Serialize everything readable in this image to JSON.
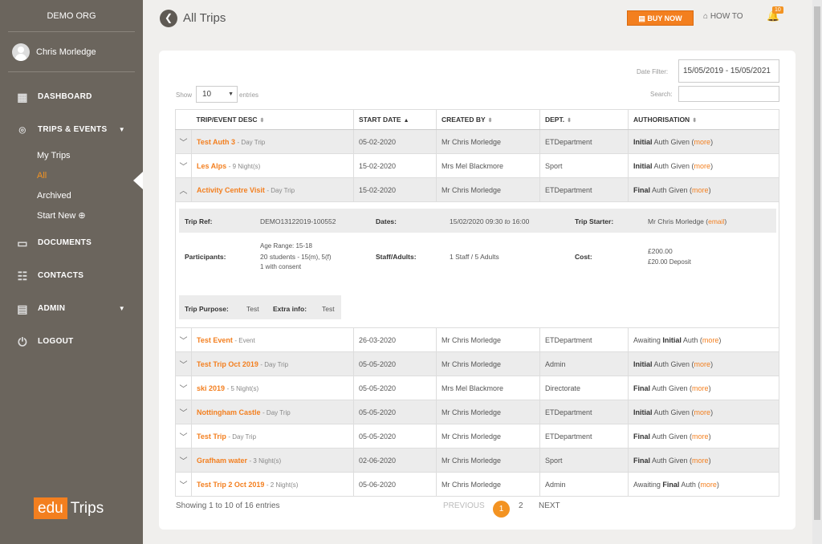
{
  "org": "DEMO ORG",
  "user": "Chris Morledge",
  "nav": {
    "dashboard": "DASHBOARD",
    "trips": "TRIPS & EVENTS",
    "my_trips": "My Trips",
    "all": "All",
    "archived": "Archived",
    "start_new": "Start New",
    "documents": "DOCUMENTS",
    "contacts": "CONTACTS",
    "admin": "ADMIN",
    "logout": "LOGOUT"
  },
  "logo": {
    "left": "edu",
    "right": "Trips"
  },
  "header": {
    "title": "All Trips",
    "buy": "BUY NOW",
    "howto": "HOW TO",
    "notif_count": "10"
  },
  "filters": {
    "date_label": "Date Filter:",
    "date_value": "15/05/2019 - 15/05/2021",
    "show": "Show",
    "entries_value": "10",
    "entries": "entries",
    "search_label": "Search:"
  },
  "columns": [
    "TRIP/EVENT DESC",
    "START DATE",
    "CREATED BY",
    "DEPT.",
    "AUTHORISATION"
  ],
  "rows": [
    {
      "name": "Test Auth 3",
      "sub": "- Day Trip",
      "date": "05-02-2020",
      "by": "Mr Chris Morledge",
      "dept": "ETDepartment",
      "auth_pre": "",
      "auth_b": "Initial",
      "auth_post": " Auth Given (",
      "more": "more"
    },
    {
      "name": "Les Alps",
      "sub": "- 9 Night(s)",
      "date": "15-02-2020",
      "by": "Mrs Mel Blackmore",
      "dept": "Sport",
      "auth_pre": "",
      "auth_b": "Initial",
      "auth_post": " Auth Given (",
      "more": "more"
    },
    {
      "name": "Activity Centre Visit",
      "sub": "- Day Trip",
      "date": "15-02-2020",
      "by": "Mr Chris Morledge",
      "dept": "ETDepartment",
      "auth_pre": "",
      "auth_b": "Final",
      "auth_post": " Auth Given (",
      "more": "more"
    },
    {
      "name": "Test Event",
      "sub": "- Event",
      "date": "26-03-2020",
      "by": "Mr Chris Morledge",
      "dept": "ETDepartment",
      "auth_pre": "Awaiting ",
      "auth_b": "Initial",
      "auth_post": " Auth (",
      "more": "more"
    },
    {
      "name": "Test Trip Oct 2019",
      "sub": "- Day Trip",
      "date": "05-05-2020",
      "by": "Mr Chris Morledge",
      "dept": "Admin",
      "auth_pre": "",
      "auth_b": "Initial",
      "auth_post": " Auth Given (",
      "more": "more"
    },
    {
      "name": "ski 2019",
      "sub": "- 5 Night(s)",
      "date": "05-05-2020",
      "by": "Mrs Mel Blackmore",
      "dept": "Directorate",
      "auth_pre": "",
      "auth_b": "Final",
      "auth_post": " Auth Given (",
      "more": "more"
    },
    {
      "name": "Nottingham Castle",
      "sub": "- Day Trip",
      "date": "05-05-2020",
      "by": "Mr Chris Morledge",
      "dept": "ETDepartment",
      "auth_pre": "",
      "auth_b": "Initial",
      "auth_post": " Auth Given (",
      "more": "more"
    },
    {
      "name": "Test Trip",
      "sub": "- Day Trip",
      "date": "05-05-2020",
      "by": "Mr Chris Morledge",
      "dept": "ETDepartment",
      "auth_pre": "",
      "auth_b": "Final",
      "auth_post": " Auth Given (",
      "more": "more"
    },
    {
      "name": "Grafham water",
      "sub": "- 3 Night(s)",
      "date": "02-06-2020",
      "by": "Mr Chris Morledge",
      "dept": "Sport",
      "auth_pre": "",
      "auth_b": "Final",
      "auth_post": " Auth Given (",
      "more": "more"
    },
    {
      "name": "Test Trip 2 Oct 2019",
      "sub": "- 2 Night(s)",
      "date": "05-06-2020",
      "by": "Mr Chris Morledge",
      "dept": "Admin",
      "auth_pre": "Awaiting ",
      "auth_b": "Final",
      "auth_post": " Auth (",
      "more": "more"
    }
  ],
  "detail": {
    "trip_ref_label": "Trip Ref:",
    "trip_ref": "DEMO13122019-100552",
    "dates_label": "Dates:",
    "dates_start": "15/02/2020 09:30",
    "dates_to": "to",
    "dates_end": "16:00",
    "starter_label": "Trip Starter:",
    "starter": "Mr Chris Morledge (",
    "starter_email": "email",
    "participants_label": "Participants:",
    "age_range": "Age Range: 15-18",
    "students": "20 students",
    "students_split": "- 15(m), 5(f)",
    "consent": "1 with consent",
    "staff_label": "Staff/Adults:",
    "staff": "1 Staff / 5 Adults",
    "cost_label": "Cost:",
    "cost": "£200.00",
    "deposit": "£20.00 Deposit",
    "purpose_label": "Trip Purpose:",
    "purpose": "Test",
    "extra_label": "Extra info:",
    "extra": "Test"
  },
  "footer": {
    "showing": "Showing 1 to 10 of 16 entries",
    "previous": "PREVIOUS",
    "page1": "1",
    "page2": "2",
    "next": "NEXT"
  }
}
